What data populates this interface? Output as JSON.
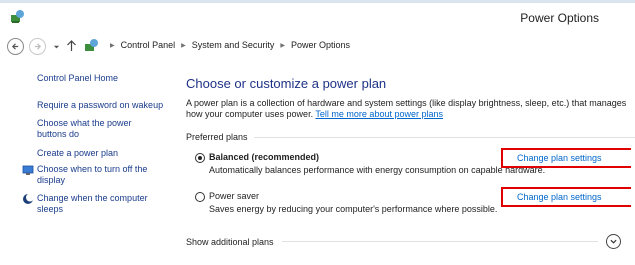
{
  "window": {
    "title": "Power Options"
  },
  "address": {
    "crumbs": [
      "Control Panel",
      "System and Security",
      "Power Options"
    ]
  },
  "sidebar": {
    "home": "Control Panel Home",
    "items": [
      "Require a password on wakeup",
      "Choose what the power buttons do",
      "Create a power plan",
      "Choose when to turn off the display",
      "Change when the computer sleeps"
    ]
  },
  "main": {
    "title": "Choose or customize a power plan",
    "intro": "A power plan is a collection of hardware and system settings (like display brightness, sleep, etc.) that manages how your computer uses power.",
    "intro_link": "Tell me more about power plans",
    "preferred_label": "Preferred plans",
    "plans": [
      {
        "name": "Balanced (recommended)",
        "desc": "Automatically balances performance with energy consumption on capable hardware.",
        "selected": true,
        "change": "Change plan settings"
      },
      {
        "name": "Power saver",
        "desc": "Saves energy by reducing your computer's performance where possible.",
        "selected": false,
        "change": "Change plan settings"
      }
    ],
    "additional": "Show additional plans"
  },
  "colors": {
    "link": "#0066cc",
    "title": "#1e3287",
    "sidebar_link": "#1a3c8c",
    "highlight": "#e00000"
  },
  "icons": [
    "power-options-icon",
    "back-arrow-icon",
    "forward-arrow-icon",
    "chevron-down-icon",
    "up-arrow-icon",
    "control-panel-icon",
    "display-icon",
    "moon-icon",
    "expand-icon"
  ]
}
